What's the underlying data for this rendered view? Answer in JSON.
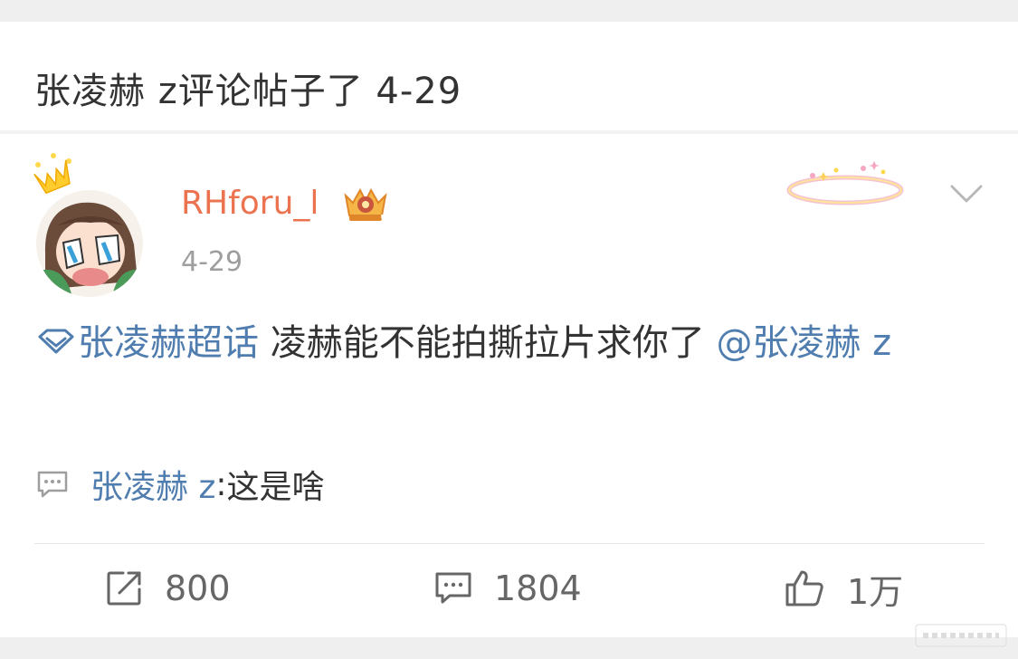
{
  "header": {
    "title": "张凌赫 z评论帖子了 4-29"
  },
  "post": {
    "username": "RHforu_l",
    "time": "4-29",
    "badge_icon": "vip-level-5-badge",
    "topic_link": "张凌赫超话",
    "body_text": " 凌赫能不能拍撕拉片求你了 ",
    "mention_link": "@张凌赫 z"
  },
  "reply": {
    "user": "张凌赫 z",
    "separator": ": ",
    "text": "这是啥"
  },
  "actions": {
    "repost_count": "800",
    "comment_count": "1804",
    "like_count": "1万"
  },
  "colors": {
    "username": "#eb7350",
    "link": "#507daf",
    "text": "#333333",
    "muted": "#9e9e9e"
  }
}
